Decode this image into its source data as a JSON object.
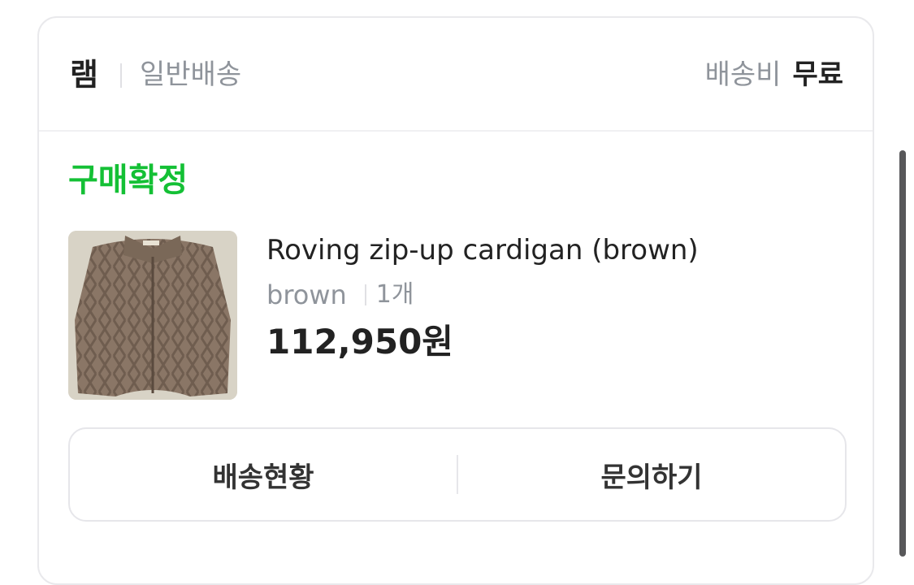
{
  "header": {
    "store_name": "램",
    "delivery_type": "일반배송",
    "fee_label": "배송비",
    "fee_value": "무료"
  },
  "order": {
    "status": "구매확정",
    "status_color": "#14c035",
    "product": {
      "name": "Roving zip-up cardigan (brown)",
      "option": "brown",
      "quantity": "1개",
      "price": "112,950원"
    }
  },
  "actions": {
    "track_label": "배송현황",
    "inquiry_label": "문의하기"
  }
}
